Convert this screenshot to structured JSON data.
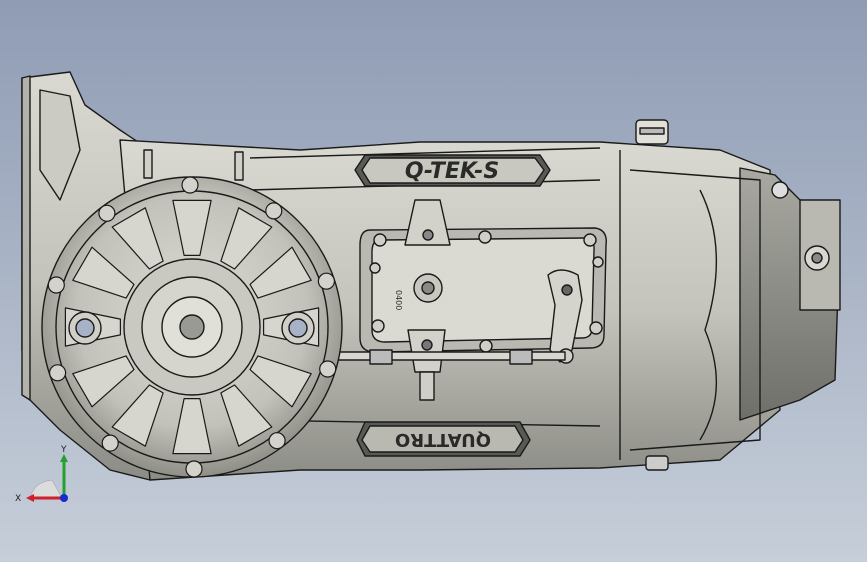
{
  "viewport": {
    "background_top": "#8f9cb4",
    "background_bottom": "#c6ced9",
    "model_name_top": "Q-TEK-S",
    "model_name_bottom": "QUATTRO",
    "plate_text": "0400"
  },
  "triad": {
    "x_label": "X",
    "y_label": "Y",
    "x_color": "#d0202a",
    "y_color": "#22a030",
    "z_color": "#1a2ad0"
  }
}
